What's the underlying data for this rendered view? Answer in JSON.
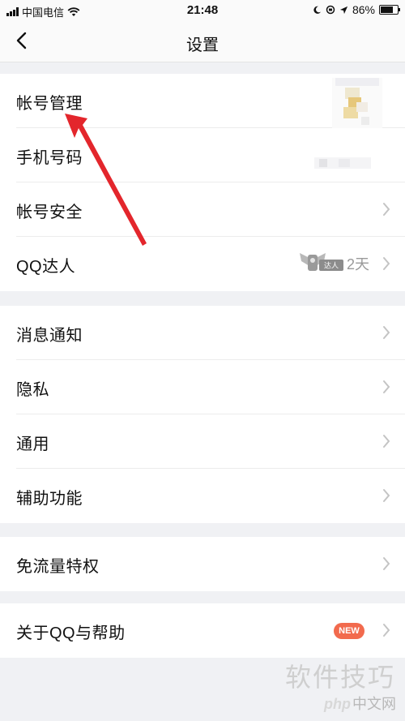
{
  "status_bar": {
    "carrier": "中国电信",
    "time": "21:48",
    "battery": "86%",
    "battery_level": 0.86
  },
  "nav": {
    "title": "设置",
    "back_icon": "chevron-left-icon"
  },
  "groups": [
    {
      "items": [
        {
          "label": "帐号管理"
        },
        {
          "label": "手机号码"
        },
        {
          "label": "帐号安全"
        },
        {
          "label": "QQ达人",
          "badge_text": "达人",
          "value": "2天"
        }
      ]
    },
    {
      "items": [
        {
          "label": "消息通知"
        },
        {
          "label": "隐私"
        },
        {
          "label": "通用"
        },
        {
          "label": "辅助功能"
        }
      ]
    },
    {
      "items": [
        {
          "label": "免流量特权"
        }
      ]
    },
    {
      "items": [
        {
          "label": "关于QQ与帮助",
          "badge": "NEW"
        }
      ]
    }
  ],
  "watermark": {
    "line1": "软件技巧",
    "php": "php",
    "site": "中文网"
  },
  "colors": {
    "annotation_arrow": "#e3262c",
    "new_badge": "#f26a4d",
    "background": "#f0f1f4"
  }
}
